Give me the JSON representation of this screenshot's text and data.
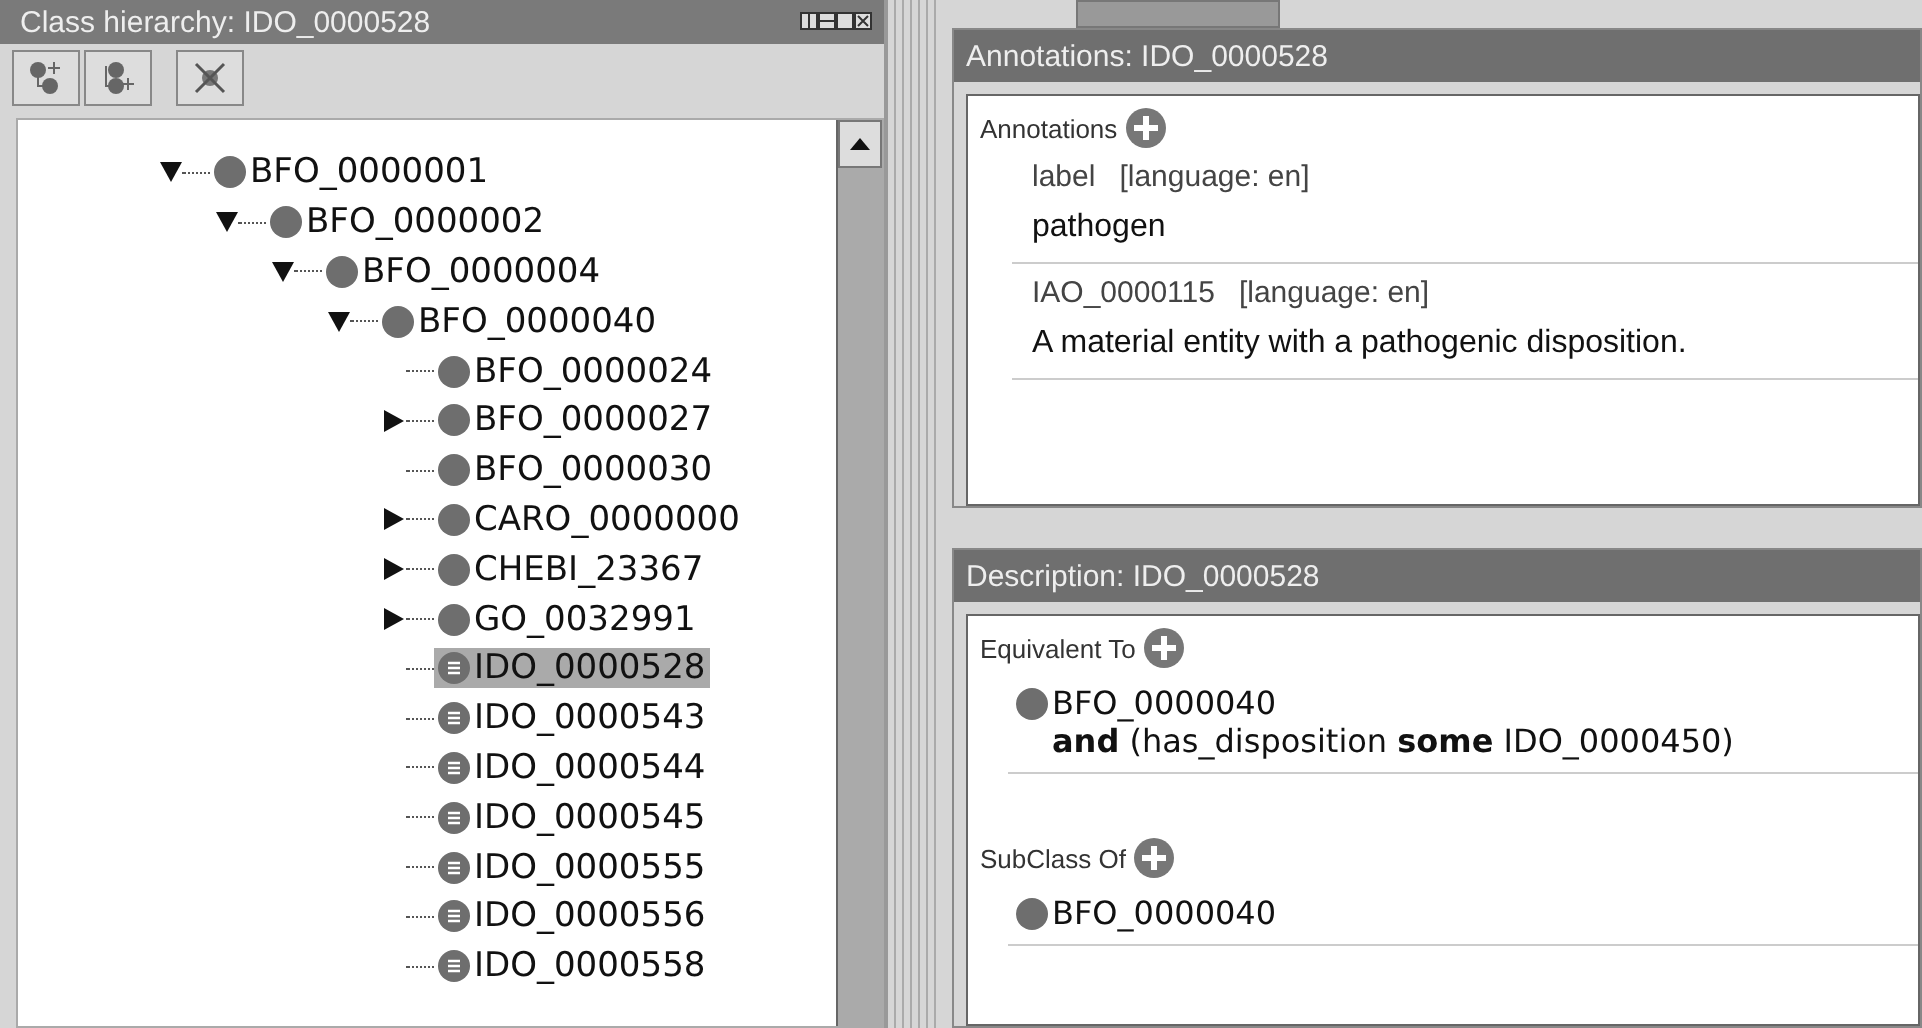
{
  "hierarchy_panel": {
    "title": "Class hierarchy: IDO_0000528",
    "tree": [
      {
        "label": "BFO_0000001",
        "kind": "class",
        "expanded": true,
        "selected": false,
        "children": [
          {
            "label": "BFO_0000002",
            "kind": "class",
            "expanded": true,
            "selected": false,
            "children": [
              {
                "label": "BFO_0000004",
                "kind": "class",
                "expanded": true,
                "selected": false,
                "children": [
                  {
                    "label": "BFO_0000040",
                    "kind": "class",
                    "expanded": true,
                    "selected": false,
                    "children": [
                      {
                        "label": "BFO_0000024",
                        "kind": "class",
                        "selected": false
                      },
                      {
                        "label": "BFO_0000027",
                        "kind": "class",
                        "expanded": false,
                        "selected": false
                      },
                      {
                        "label": "BFO_0000030",
                        "kind": "class",
                        "selected": false
                      },
                      {
                        "label": "CARO_0000000",
                        "kind": "class",
                        "expanded": false,
                        "selected": false
                      },
                      {
                        "label": "CHEBI_23367",
                        "kind": "class",
                        "expanded": false,
                        "selected": false
                      },
                      {
                        "label": "GO_0032991",
                        "kind": "class",
                        "expanded": false,
                        "selected": false
                      },
                      {
                        "label": "IDO_0000528",
                        "kind": "defined",
                        "selected": true
                      },
                      {
                        "label": "IDO_0000543",
                        "kind": "defined",
                        "selected": false
                      },
                      {
                        "label": "IDO_0000544",
                        "kind": "defined",
                        "selected": false
                      },
                      {
                        "label": "IDO_0000545",
                        "kind": "defined",
                        "selected": false
                      },
                      {
                        "label": "IDO_0000555",
                        "kind": "defined",
                        "selected": false
                      },
                      {
                        "label": "IDO_0000556",
                        "kind": "defined",
                        "selected": false
                      },
                      {
                        "label": "IDO_0000558",
                        "kind": "defined",
                        "selected": false
                      }
                    ]
                  }
                ]
              }
            ]
          }
        ]
      }
    ]
  },
  "annotations_panel": {
    "title": "Annotations: IDO_0000528",
    "section": "Annotations",
    "items": [
      {
        "property": "label",
        "language": "[language: en]",
        "value": "pathogen"
      },
      {
        "property": "IAO_0000115",
        "language": "[language: en]",
        "value": "A material entity with a pathogenic disposition."
      }
    ]
  },
  "description_panel": {
    "title": "Description: IDO_0000528",
    "sections": [
      {
        "heading": "Equivalent To",
        "entries": [
          {
            "class": "BFO_0000040",
            "expression": "**and** (has_disposition **some** IDO_0000450)"
          }
        ]
      },
      {
        "heading": "SubClass Of",
        "entries": [
          {
            "class": "BFO_0000040"
          }
        ]
      }
    ]
  }
}
